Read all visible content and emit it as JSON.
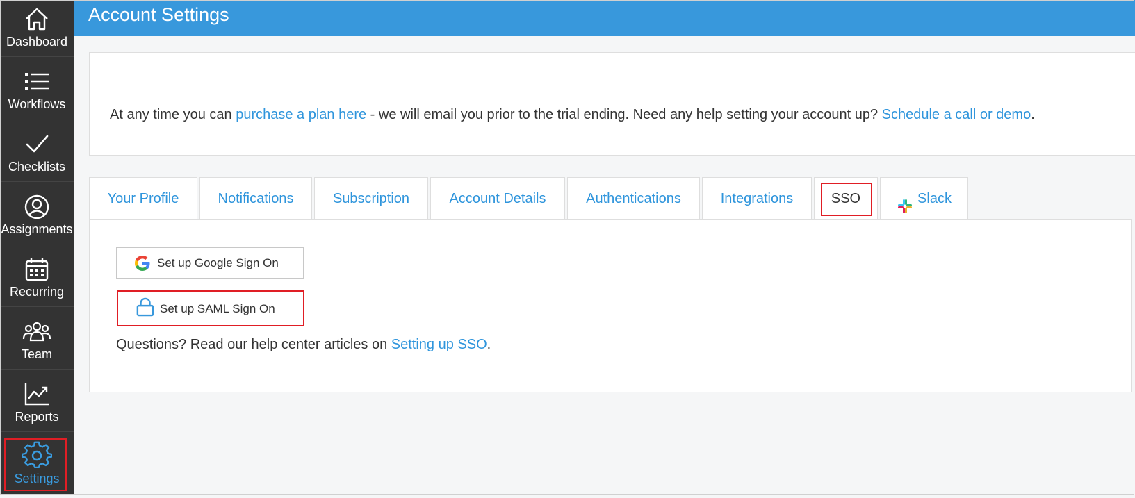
{
  "sidebar": {
    "items": [
      {
        "label": "Dashboard",
        "icon": "home-icon"
      },
      {
        "label": "Workflows",
        "icon": "list-icon"
      },
      {
        "label": "Checklists",
        "icon": "check-icon"
      },
      {
        "label": "Assignments",
        "icon": "user-circle-icon"
      },
      {
        "label": "Recurring",
        "icon": "calendar-icon"
      },
      {
        "label": "Team",
        "icon": "team-icon"
      },
      {
        "label": "Reports",
        "icon": "chart-icon"
      },
      {
        "label": "Settings",
        "icon": "gear-icon",
        "active": true
      }
    ]
  },
  "header": {
    "title": "Account Settings"
  },
  "info": {
    "text_1": "At any time you can ",
    "link_1": "purchase a plan here",
    "text_2": " - we will email you prior to the trial ending. Need any help setting your account up? ",
    "link_2": "Schedule a call or demo",
    "text_3": "."
  },
  "tabs": [
    {
      "label": "Your Profile"
    },
    {
      "label": "Notifications"
    },
    {
      "label": "Subscription"
    },
    {
      "label": "Account Details"
    },
    {
      "label": "Authentications"
    },
    {
      "label": "Integrations"
    },
    {
      "label": "SSO",
      "active": true
    },
    {
      "label": "Slack",
      "icon": "slack-icon"
    }
  ],
  "sso": {
    "google_button": "Set up Google Sign On",
    "saml_button": "Set up SAML Sign On",
    "questions_text": "Questions? Read our help center articles on ",
    "questions_link": "Setting up SSO",
    "questions_end": "."
  },
  "colors": {
    "accent": "#3898dc",
    "link": "#2f95dc",
    "sidebar_bg": "#333333",
    "highlight": "#e01e25"
  }
}
